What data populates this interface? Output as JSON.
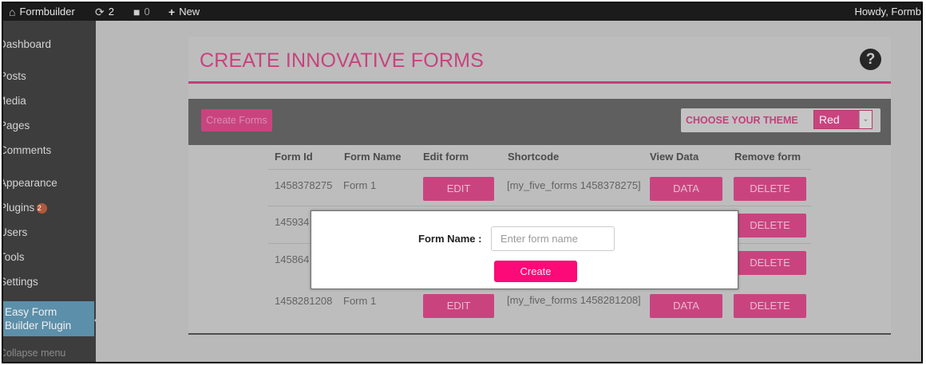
{
  "adminbar": {
    "site_name": "Formbuilder",
    "updates_count": "2",
    "comments_count": "0",
    "new_label": "New",
    "howdy": "Howdy, Formb"
  },
  "sidebar": {
    "items": [
      {
        "label": "Dashboard"
      },
      {
        "label": "Posts"
      },
      {
        "label": "Media"
      },
      {
        "label": "Pages"
      },
      {
        "label": "Comments"
      },
      {
        "label": "Appearance"
      },
      {
        "label": "Plugins",
        "badge": "2"
      },
      {
        "label": "Users"
      },
      {
        "label": "Tools"
      },
      {
        "label": "Settings"
      }
    ],
    "active_item": "Easy Form Builder Plugin",
    "collapse_label": "Collapse menu"
  },
  "page": {
    "title": "CREATE INNOVATIVE FORMS",
    "help_glyph": "?"
  },
  "toolbar": {
    "create_forms_label": "Create Forms",
    "theme_label": "CHOOSE YOUR THEME",
    "theme_value": "Red"
  },
  "table": {
    "headers": [
      "Form Id",
      "Form Name",
      "Edit form",
      "Shortcode",
      "View Data",
      "Remove form"
    ],
    "rows": [
      {
        "id": "1458378275",
        "name": "Form 1",
        "edit": "EDIT",
        "shortcode": "[my_five_forms 1458378275]",
        "data": "DATA",
        "delete": "DELETE"
      },
      {
        "id": "145934",
        "name": "",
        "edit": "",
        "shortcode": "",
        "data": "",
        "delete": "DELETE"
      },
      {
        "id": "145864",
        "name": "",
        "edit": "",
        "shortcode": "",
        "data": "",
        "delete": "DELETE"
      },
      {
        "id": "1458281208",
        "name": "Form 1",
        "edit": "EDIT",
        "shortcode": "[my_five_forms 1458281208]",
        "data": "DATA",
        "delete": "DELETE"
      }
    ]
  },
  "modal": {
    "label": "Form Name :",
    "placeholder": "Enter form name",
    "create_label": "Create"
  },
  "colors": {
    "accent": "#c9447f",
    "create_button": "#fb0a78",
    "admin_bar": "#1b1b1b",
    "sidebar": "#3d3d3d",
    "active_menu": "#5c8fa9"
  }
}
